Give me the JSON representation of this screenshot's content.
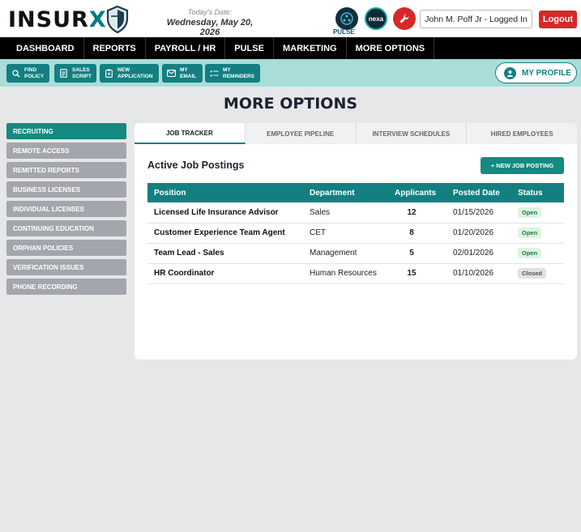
{
  "header": {
    "logo_text": "INSURX",
    "date_caption": "Today's Date:",
    "date_value": "Wednesday, May 20, 2026",
    "pulse_label": "PULSE",
    "nexa_label": "nexa",
    "user_label": "John M. Poff Jr - Logged In",
    "logout_label": "Logout"
  },
  "nav": {
    "items": [
      {
        "label": "DASHBOARD"
      },
      {
        "label": "REPORTS"
      },
      {
        "label": "PAYROLL / HR"
      },
      {
        "label": "PULSE"
      },
      {
        "label": "MARKETING"
      },
      {
        "label": "MORE OPTIONS"
      }
    ]
  },
  "toolbar": {
    "find_policy": [
      "FIND",
      "POLICY"
    ],
    "sales_script": [
      "SALES",
      "SCRIPT"
    ],
    "new_application": [
      "NEW",
      "APPLICATION"
    ],
    "my_email": [
      "MY",
      "EMAIL"
    ],
    "my_reminders": [
      "MY",
      "REMINDERS"
    ],
    "profile_label": "MY PROFILE"
  },
  "page": {
    "title": "MORE OPTIONS"
  },
  "sidebar": {
    "items": [
      {
        "label": "RECRUITING",
        "active": true
      },
      {
        "label": "REMOTE ACCESS"
      },
      {
        "label": "REMITTED REPORTS"
      },
      {
        "label": "BUSINESS LICENSES"
      },
      {
        "label": "INDIVIDUAL LICENSES"
      },
      {
        "label": "CONTINUING EDUCATION"
      },
      {
        "label": "ORPHAN POLICIES"
      },
      {
        "label": "VERIFICATION ISSUES"
      },
      {
        "label": "PHONE RECORDING"
      }
    ]
  },
  "tabs": [
    {
      "label": "JOB TRACKER",
      "active": true
    },
    {
      "label": "EMPLOYEE PIPELINE"
    },
    {
      "label": "INTERVIEW SCHEDULES"
    },
    {
      "label": "HIRED EMPLOYEES"
    }
  ],
  "jobs": {
    "title": "Active Job Postings",
    "new_button": "+ NEW JOB POSTING",
    "columns": [
      "Position",
      "Department",
      "Applicants",
      "Posted Date",
      "Status"
    ],
    "rows": [
      {
        "position": "Licensed Life Insurance Advisor",
        "department": "Sales",
        "applicants": "12",
        "posted": "01/15/2026",
        "status": "Open"
      },
      {
        "position": "Customer Experience Team Agent",
        "department": "CET",
        "applicants": "8",
        "posted": "01/20/2026",
        "status": "Open"
      },
      {
        "position": "Team Lead - Sales",
        "department": "Management",
        "applicants": "5",
        "posted": "02/01/2026",
        "status": "Open"
      },
      {
        "position": "HR Coordinator",
        "department": "Human Resources",
        "applicants": "15",
        "posted": "01/10/2026",
        "status": "Closed"
      }
    ]
  },
  "colors": {
    "brand_teal": "#137f80",
    "toolbar_bg": "#a9ddd8",
    "logout_red": "#d62828",
    "nav_bg": "#000000"
  }
}
